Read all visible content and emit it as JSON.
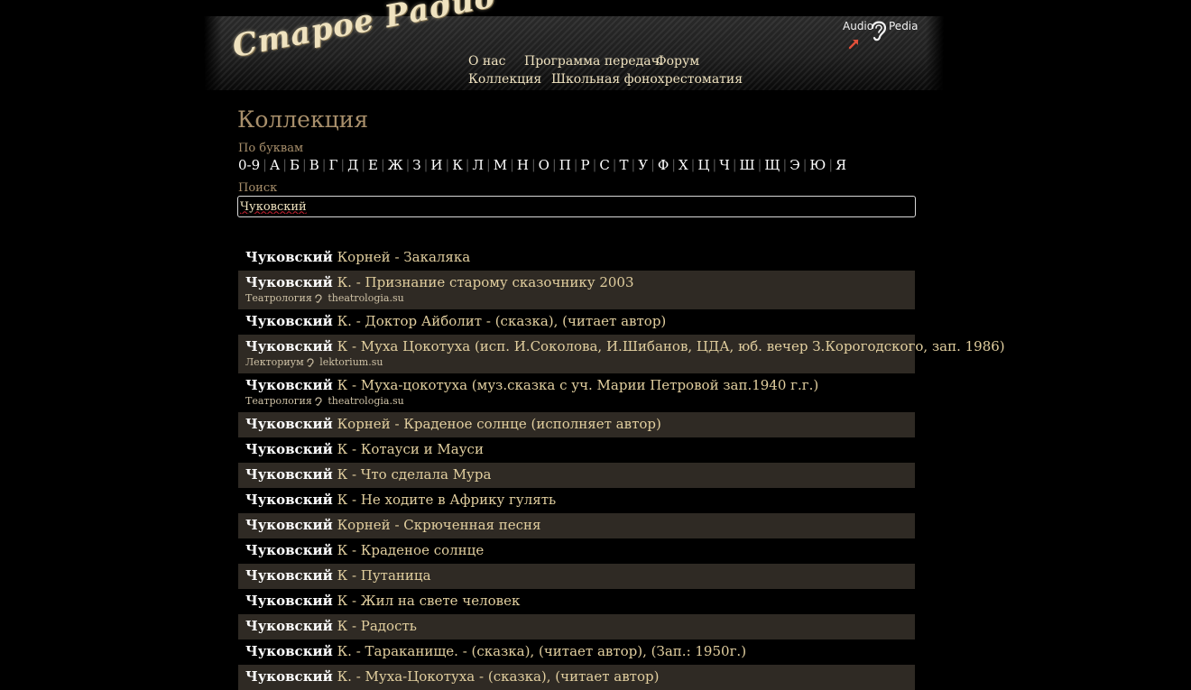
{
  "header": {
    "logo_text": "Старое Радио",
    "audiopedia": {
      "left": "Audio",
      "right": "Pedia"
    },
    "nav": [
      {
        "label": "О нас"
      },
      {
        "label": "Программа передач"
      },
      {
        "label": "Форум"
      },
      {
        "label": "Коллекция"
      },
      {
        "label": "Школьная фонохрестоматия"
      }
    ]
  },
  "page_title": "Коллекция",
  "by_letters": {
    "label": "По буквам",
    "letters": [
      "0-9",
      "А",
      "Б",
      "В",
      "Г",
      "Д",
      "Е",
      "Ж",
      "З",
      "И",
      "К",
      "Л",
      "М",
      "Н",
      "О",
      "П",
      "Р",
      "С",
      "Т",
      "У",
      "Ф",
      "Х",
      "Ц",
      "Ч",
      "Ш",
      "Щ",
      "Э",
      "Ю",
      "Я"
    ]
  },
  "search": {
    "label": "Поиск",
    "value": "Чуковский"
  },
  "results": [
    {
      "author": "Чуковский",
      "title": "Корней - Закаляка"
    },
    {
      "author": "Чуковский",
      "title": "К. - Признание старому сказочнику 2003",
      "source": {
        "name": "Театрология",
        "site": "theatrologia.su"
      }
    },
    {
      "author": "Чуковский",
      "title": "К. - Доктор Айболит - (сказка), (читает автор)"
    },
    {
      "author": "Чуковский",
      "title": "К - Муха Цокотуха (исп. И.Соколова, И.Шибанов, ЦДА, юб. вечер З.Корогодского, зап. 1986)",
      "source": {
        "name": "Лекториум",
        "site": "lektorium.su"
      }
    },
    {
      "author": "Чуковский",
      "title": "К - Муха-цокотуха (муз.сказка с уч. Марии Петровой зап.1940 г.г.)",
      "source": {
        "name": "Театрология",
        "site": "theatrologia.su"
      }
    },
    {
      "author": "Чуковский",
      "title": "Корней - Краденое солнце (исполняет автор)"
    },
    {
      "author": "Чуковский",
      "title": "К - Котауси и Мауси"
    },
    {
      "author": "Чуковский",
      "title": "К - Что сделала Мура"
    },
    {
      "author": "Чуковский",
      "title": "К - Не ходите в Африку гулять"
    },
    {
      "author": "Чуковский",
      "title": "Корней - Скрюченная песня"
    },
    {
      "author": "Чуковский",
      "title": "К - Краденое солнце"
    },
    {
      "author": "Чуковский",
      "title": "К - Путаница"
    },
    {
      "author": "Чуковский",
      "title": "К - Жил на свете человек"
    },
    {
      "author": "Чуковский",
      "title": "К - Радость"
    },
    {
      "author": "Чуковский",
      "title": "К. - Тараканище. - (сказка), (читает автор), (Зап.: 1950г.)"
    },
    {
      "author": "Чуковский",
      "title": "К. - Муха-Цокотуха - (сказка), (читает автор)"
    }
  ]
}
